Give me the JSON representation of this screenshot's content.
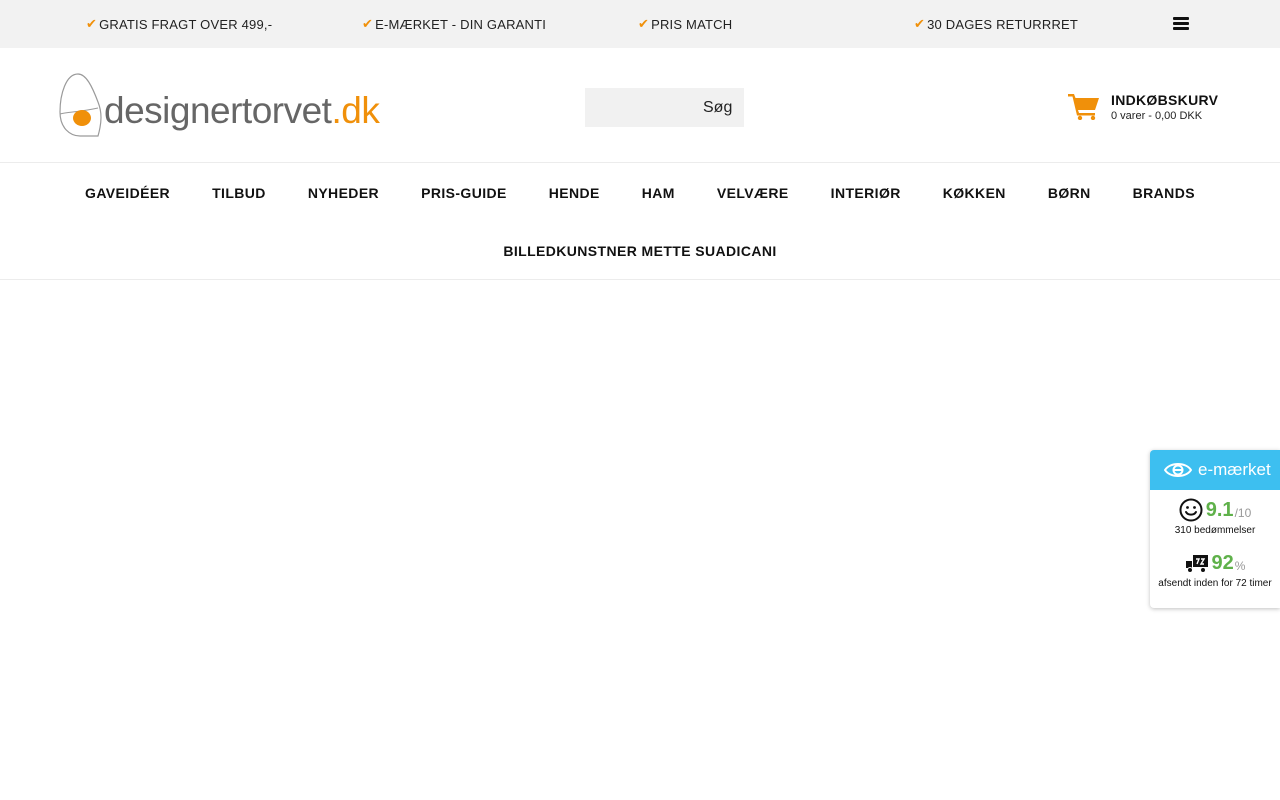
{
  "topbar": {
    "usps": [
      {
        "icon": "check-icon",
        "text": "GRATIS FRAGT OVER 499,-"
      },
      {
        "icon": "check-icon",
        "text": "E-MÆRKET - DIN GARANTI"
      },
      {
        "icon": "check-icon",
        "text": "PRIS MATCH"
      },
      {
        "icon": "check-icon",
        "text": "30 DAGES RETURRRET"
      }
    ],
    "menu_icon": "hamburger-menu-icon",
    "accent_color": "#f0900a"
  },
  "header": {
    "logo": {
      "name": "designertorvet",
      "tld": ".dk"
    },
    "search": {
      "value": "",
      "placeholder": "",
      "button_label": "Søg"
    },
    "cart": {
      "icon": "shopping-cart-icon",
      "title": "INDKØBSKURV",
      "summary": "0 varer - 0,00 DKK"
    }
  },
  "nav": {
    "row1": [
      "GAVEIDÉER",
      "TILBUD",
      "NYHEDER",
      "PRIS-GUIDE",
      "HENDE",
      "HAM",
      "VELVÆRE",
      "INTERIØR",
      "KØKKEN",
      "BØRN",
      "BRANDS"
    ],
    "row2": [
      "BILLEDKUNSTNER METTE SUADICANI"
    ]
  },
  "emaerket_widget": {
    "title": "e-mærket",
    "header_color": "#3dbff0",
    "rating": {
      "icon": "smiley-icon",
      "score": "9.1",
      "max": "/10",
      "caption": "310 bedømmelser"
    },
    "shipping": {
      "icon": "delivery-truck-icon",
      "value": "92",
      "unit": "%",
      "caption": "afsendt inden for 72 timer"
    },
    "value_color": "#5fb14a"
  }
}
